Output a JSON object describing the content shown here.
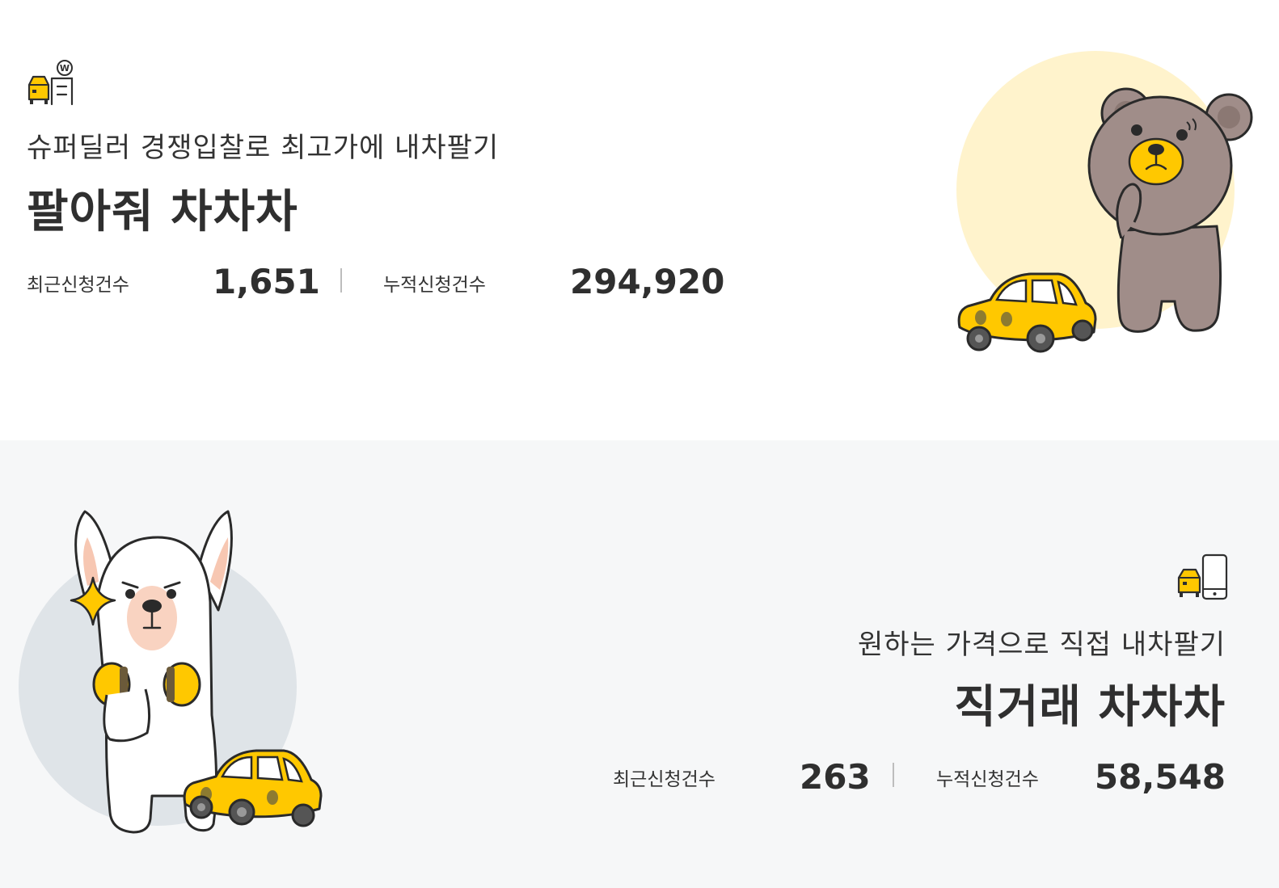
{
  "super_dealer": {
    "subtitle": "슈퍼딜러 경쟁입찰로 최고가에 내차팔기",
    "title": "팔아줘 차차차",
    "recent_label": "최근신청건수",
    "recent_value": "1,651",
    "total_label": "누적신청건수",
    "total_value": "294,920",
    "icon": "car-dealer-icon",
    "illustration": "bear-with-yellow-car"
  },
  "direct_trade": {
    "subtitle": "원하는 가격으로 직접 내차팔기",
    "title": "직거래 차차차",
    "recent_label": "최근신청건수",
    "recent_value": "263",
    "total_label": "누적신청건수",
    "total_value": "58,548",
    "icon": "car-mobile-icon",
    "illustration": "alpaca-with-yellow-car"
  },
  "colors": {
    "accent_yellow": "#ffc800",
    "bear_circle": "#fff3cc",
    "alpaca_circle": "#dfe4e8",
    "bottom_bg": "#f6f7f8",
    "text_dark": "#2f2f2f"
  }
}
